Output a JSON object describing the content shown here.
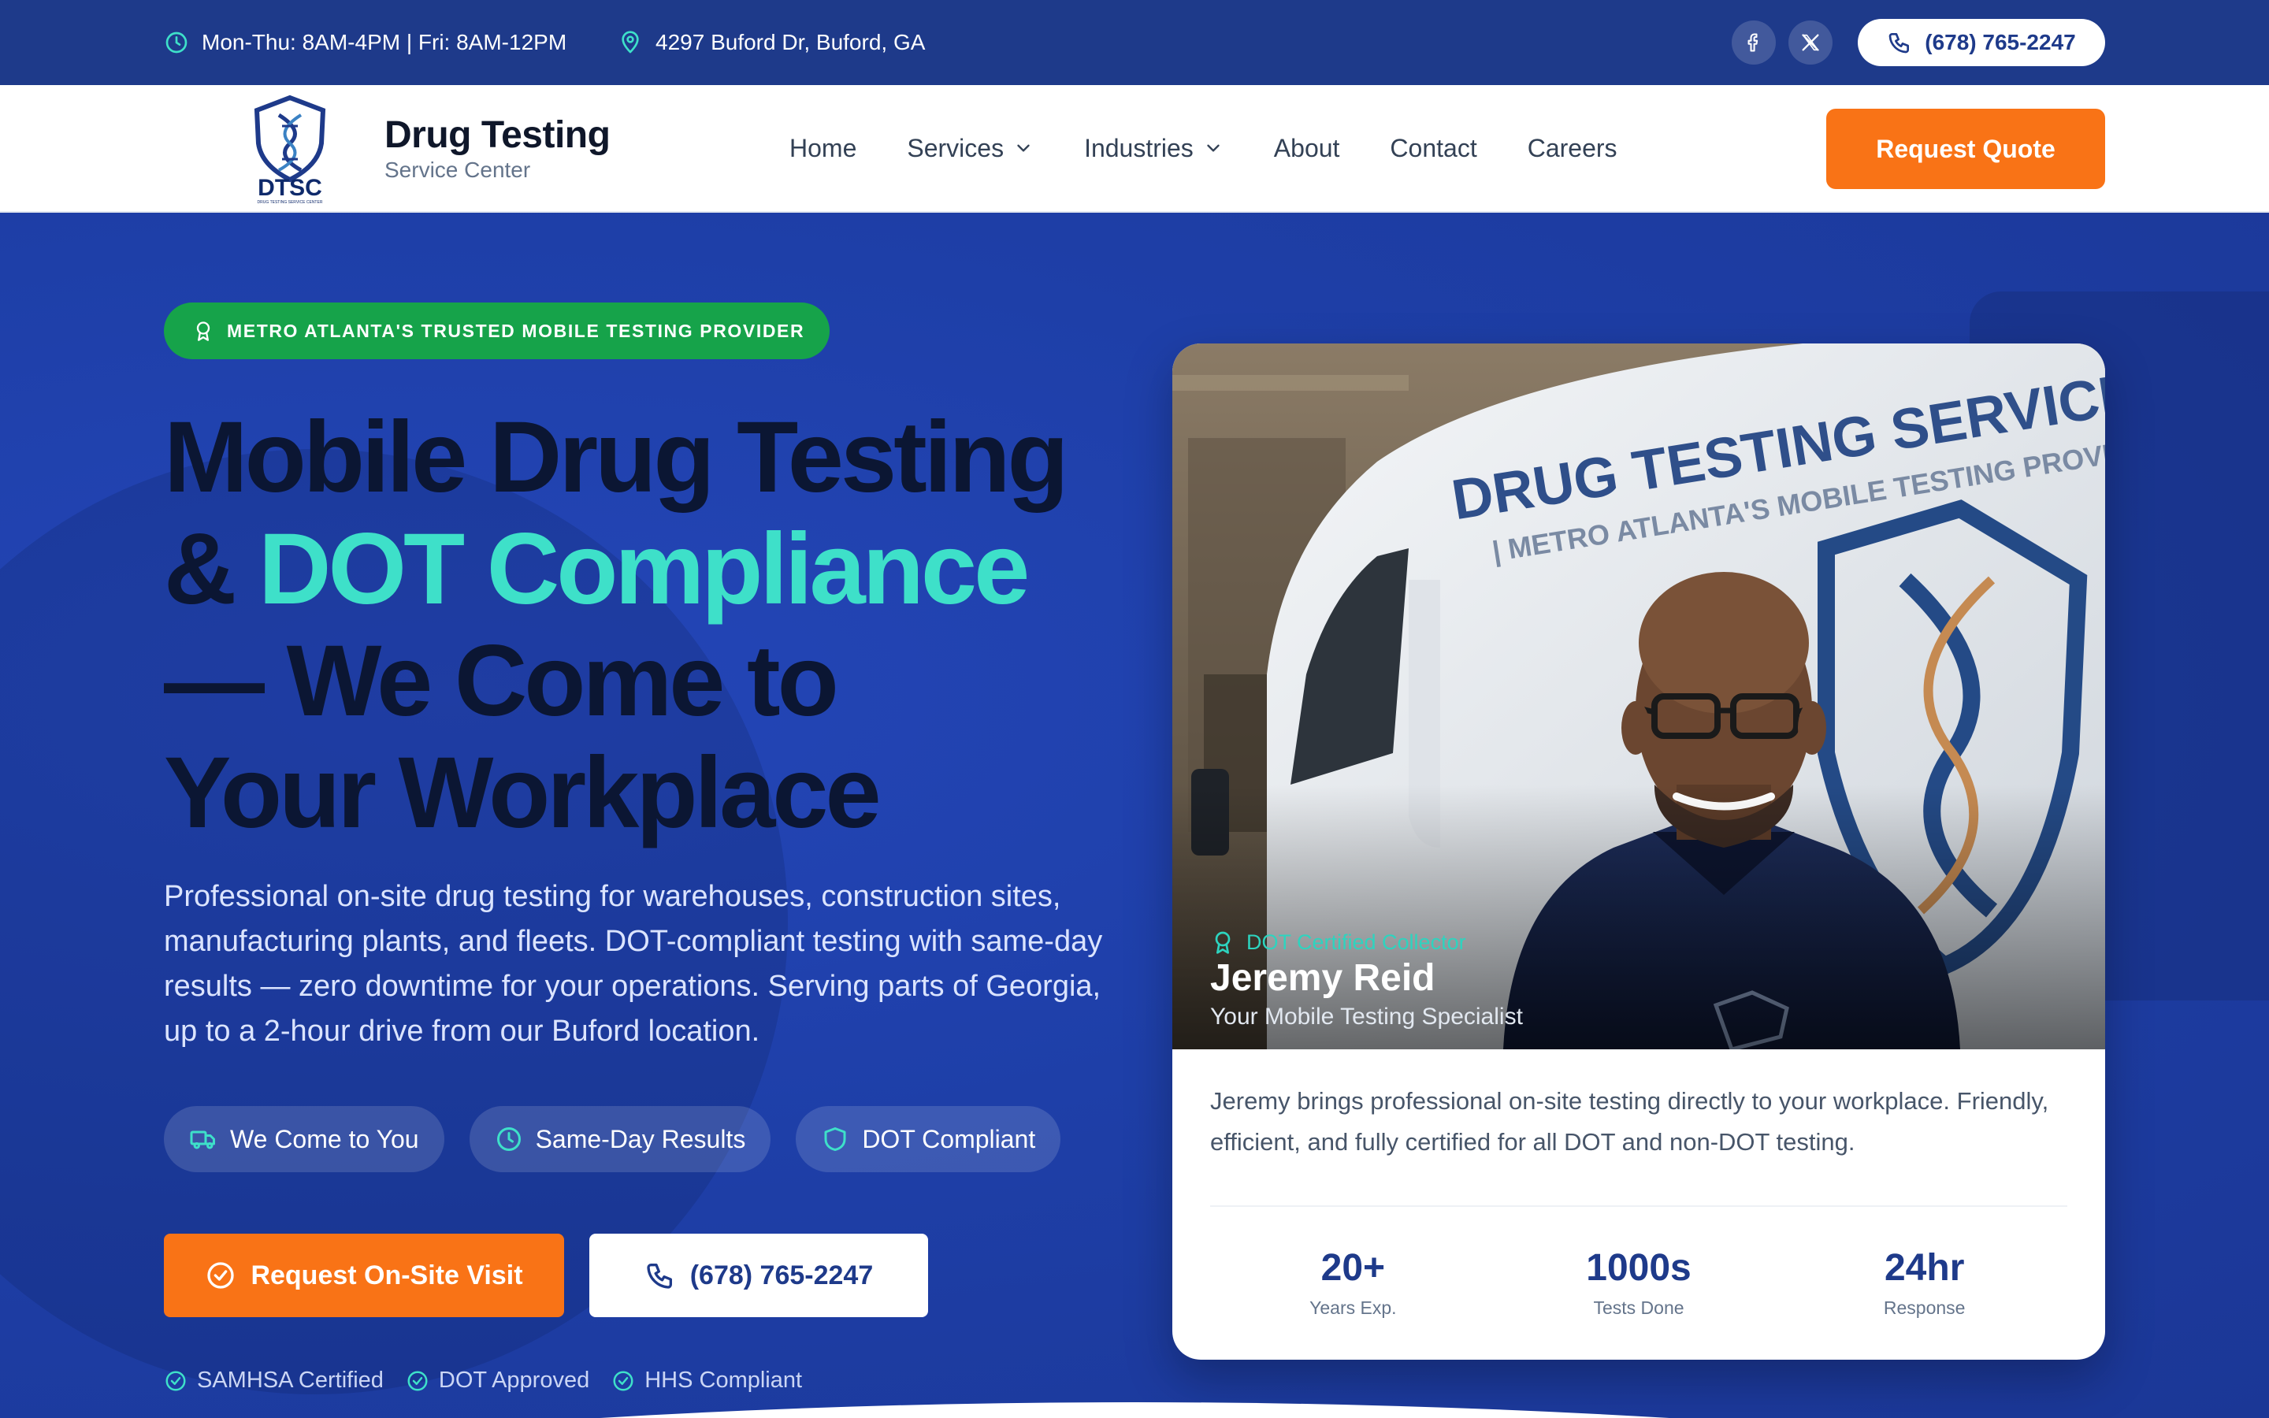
{
  "topbar": {
    "hours": "Mon-Thu: 8AM-4PM | Fri: 8AM-12PM",
    "address": "4297 Buford Dr, Buford, GA",
    "social": [
      "facebook-icon",
      "x-twitter-icon"
    ],
    "phone": "(678) 765-2247"
  },
  "header": {
    "logo_mark": "DTSC",
    "logo_mark_small": "DRUG TESTING SERVICE CENTER",
    "logo_title": "Drug Testing",
    "logo_subtitle": "Service Center",
    "nav": [
      {
        "label": "Home",
        "dropdown": false
      },
      {
        "label": "Services",
        "dropdown": true
      },
      {
        "label": "Industries",
        "dropdown": true
      },
      {
        "label": "About",
        "dropdown": false
      },
      {
        "label": "Contact",
        "dropdown": false
      },
      {
        "label": "Careers",
        "dropdown": false
      }
    ],
    "quote_button": "Request Quote"
  },
  "hero": {
    "badge": "METRO ATLANTA'S TRUSTED MOBILE TESTING PROVIDER",
    "headline": {
      "line1": "Mobile Drug Testing",
      "line2_prefix": "& ",
      "line2_accent": "DOT Compliance",
      "line3": "— We Come to",
      "line4": "Your Workplace"
    },
    "description": "Professional on-site drug testing for warehouses, construction sites, manufacturing plants, and fleets. DOT-compliant testing with same-day results — zero downtime for your operations. Serving parts of Georgia, up to a 2-hour drive from our Buford location.",
    "pills": [
      {
        "label": "We Come to You",
        "icon": "truck-icon"
      },
      {
        "label": "Same-Day Results",
        "icon": "clock-icon"
      },
      {
        "label": "DOT Compliant",
        "icon": "shield-icon"
      }
    ],
    "cta_primary": "Request On-Site Visit",
    "cta_secondary": "(678) 765-2247",
    "certifications": [
      "SAMHSA Certified",
      "DOT Approved",
      "HHS Compliant"
    ]
  },
  "profile": {
    "van_text_main": "DRUG TESTING SERVICE CENTER",
    "van_text_sub": "| METRO ATLANTA'S MOBILE TESTING PROVIDER |",
    "role": "DOT Certified Collector",
    "name": "Jeremy Reid",
    "title": "Your Mobile Testing Specialist",
    "bio": "Jeremy brings professional on-site testing directly to your workplace. Friendly, efficient, and fully certified for all DOT and non-DOT testing.",
    "stats": [
      {
        "value": "20+",
        "label": "Years Exp."
      },
      {
        "value": "1000s",
        "label": "Tests Done"
      },
      {
        "value": "24hr",
        "label": "Response"
      }
    ]
  },
  "colors": {
    "primary": "#1e3a8a",
    "hero_bg": "#1e3fa8",
    "accent_teal": "#3ee0c9",
    "orange": "#f97316",
    "green": "#16a34a"
  }
}
